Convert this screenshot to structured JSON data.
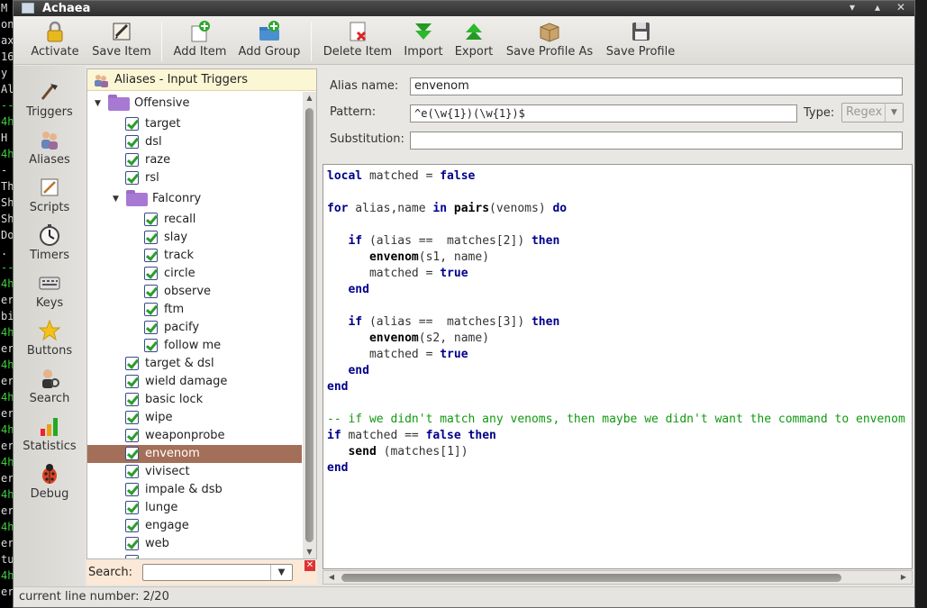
{
  "window": {
    "title": "Achaea"
  },
  "toolbar": {
    "activate": "Activate",
    "save_item": "Save Item",
    "add_item": "Add Item",
    "add_group": "Add Group",
    "delete_item": "Delete Item",
    "import": "Import",
    "export": "Export",
    "save_profile_as": "Save Profile As",
    "save_profile": "Save Profile"
  },
  "sidebar": {
    "triggers": "Triggers",
    "aliases": "Aliases",
    "scripts": "Scripts",
    "timers": "Timers",
    "keys": "Keys",
    "buttons": "Buttons",
    "search": "Search",
    "statistics": "Statistics",
    "debug": "Debug"
  },
  "tree": {
    "header": "Aliases - Input Triggers",
    "items": [
      {
        "label": "Offensive"
      },
      {
        "label": "target"
      },
      {
        "label": "dsl"
      },
      {
        "label": "raze"
      },
      {
        "label": "rsl"
      },
      {
        "label": "Falconry"
      },
      {
        "label": "recall"
      },
      {
        "label": "slay"
      },
      {
        "label": "track"
      },
      {
        "label": "circle"
      },
      {
        "label": "observe"
      },
      {
        "label": "ftm"
      },
      {
        "label": "pacify"
      },
      {
        "label": "follow me"
      },
      {
        "label": "target & dsl"
      },
      {
        "label": "wield damage"
      },
      {
        "label": "basic lock"
      },
      {
        "label": "wipe"
      },
      {
        "label": "weaponprobe"
      },
      {
        "label": "envenom"
      },
      {
        "label": "vivisect"
      },
      {
        "label": "impale & dsb"
      },
      {
        "label": "lunge"
      },
      {
        "label": "engage"
      },
      {
        "label": "web"
      }
    ]
  },
  "search": {
    "label": "Search:",
    "value": ""
  },
  "form": {
    "alias_name_label": "Alias name:",
    "alias_name": "envenom",
    "pattern_label": "Pattern:",
    "pattern": "^e(\\w{1})(\\w{1})$",
    "type_label": "Type:",
    "type_value": "Regex",
    "substitution_label": "Substitution:",
    "substitution": ""
  },
  "code": {
    "l1": [
      "local",
      " matched = ",
      "false"
    ],
    "l3": [
      "for",
      " alias,name ",
      "in",
      " ",
      "pairs",
      "(venoms) ",
      "do"
    ],
    "l5": [
      "   ",
      "if",
      " (alias ==  matches[2]) ",
      "then"
    ],
    "l6": [
      "      ",
      "envenom",
      "(s1, name)"
    ],
    "l7": [
      "      matched = ",
      "true"
    ],
    "l8": [
      "   ",
      "end"
    ],
    "l10": [
      "   ",
      "if",
      " (alias ==  matches[3]) ",
      "then"
    ],
    "l11": [
      "      ",
      "envenom",
      "(s2, name)"
    ],
    "l12": [
      "      matched = ",
      "true"
    ],
    "l13": [
      "   ",
      "end"
    ],
    "l14": [
      "end"
    ],
    "l16": "-- if we didn't match any venoms, then maybe we didn't want the command to envenom",
    "l17": [
      "if",
      " matched == ",
      "false",
      " ",
      "then"
    ],
    "l18": [
      "   ",
      "send",
      " (matches[1])"
    ],
    "l19": [
      "end"
    ]
  },
  "status": {
    "text": "current line number: 2/20"
  }
}
